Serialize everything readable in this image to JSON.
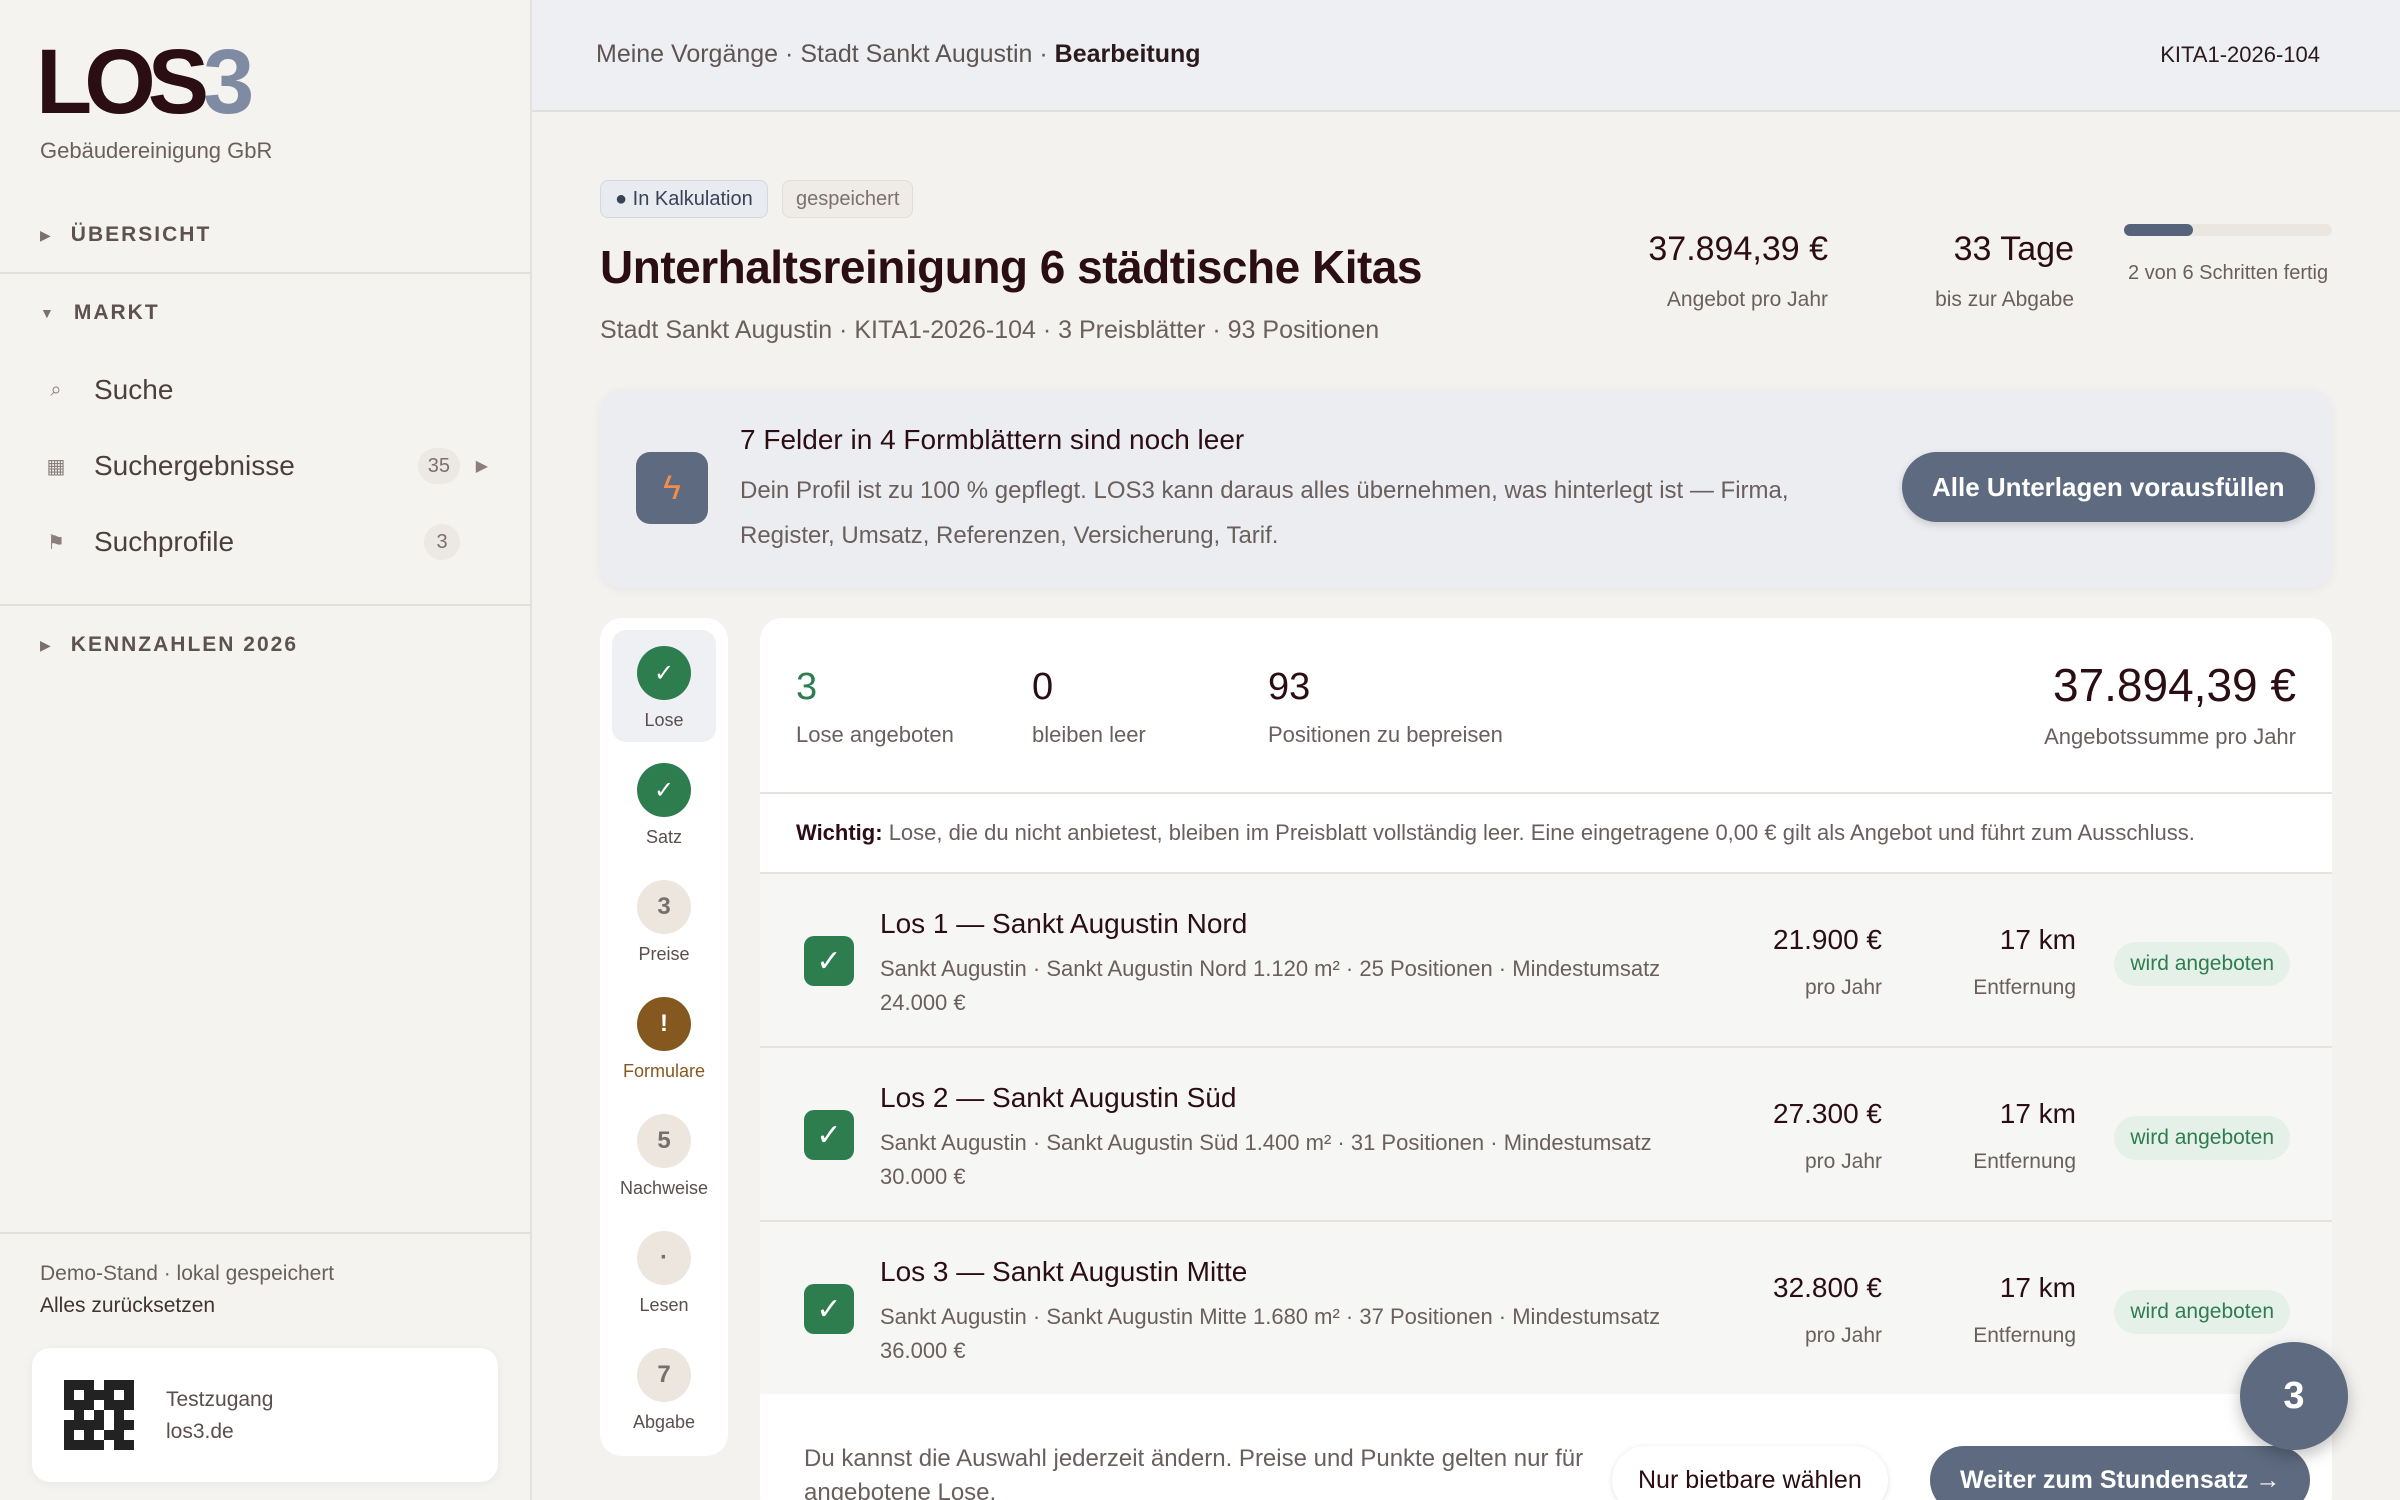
{
  "brand": {
    "logo_main": "LOS",
    "logo_accent": "3",
    "company": "Gebäudereinigung GbR"
  },
  "sidebar": {
    "sections": [
      {
        "label": "ÜBERSICHT",
        "expanded": false
      },
      {
        "label": "MARKT",
        "expanded": true
      },
      {
        "label": "KENNZAHLEN 2026",
        "expanded": false
      }
    ],
    "items": [
      {
        "label": "Suche",
        "icon": "search-icon"
      },
      {
        "label": "Suchergebnisse",
        "icon": "grid-icon",
        "count": "35"
      },
      {
        "label": "Suchprofile",
        "icon": "flag-icon",
        "count": "3"
      }
    ],
    "footer": {
      "status": "Demo-Stand · lokal gespeichert",
      "reset": "Alles zurücksetzen",
      "qr_line1": "Testzugang",
      "qr_line2": "los3.de"
    }
  },
  "topbar": {
    "crumb_1": "Meine Vorgänge",
    "crumb_2": "Stadt Sankt Augustin",
    "crumb_current": "Bearbeitung",
    "case_id": "KITA1-2026-104"
  },
  "header": {
    "status_badge": "In Kalkulation",
    "saved_badge": "gespeichert",
    "title": "Unterhaltsreinigung 6 städtische Kitas",
    "subtitle": "Stadt Sankt Augustin · KITA1-2026-104 · 3 Preisblätter · 93 Positionen",
    "kpi_offer_value": "37.894,39 €",
    "kpi_offer_label": "Angebot pro Jahr",
    "kpi_days_value": "33 Tage",
    "kpi_days_label": "bis zur Abgabe",
    "progress_fraction": 0.33,
    "progress_label": "2 von 6 Schritten fertig"
  },
  "alert": {
    "title": "7 Felder in 4 Formblättern sind noch leer",
    "text": "Dein Profil ist zu 100 % gepflegt. LOS3 kann daraus alles übernehmen, was hinterlegt ist — Firma, Register, Umsatz, Referenzen, Versicherung, Tarif.",
    "button": "Alle Unterlagen vorausfüllen"
  },
  "steps": [
    {
      "mark": "✓",
      "label": "Lose",
      "state": "done"
    },
    {
      "mark": "✓",
      "label": "Satz",
      "state": "done"
    },
    {
      "mark": "3",
      "label": "Preise",
      "state": "todo"
    },
    {
      "mark": "!",
      "label": "Formulare",
      "state": "warn"
    },
    {
      "mark": "5",
      "label": "Nachweise",
      "state": "todo"
    },
    {
      "mark": "·",
      "label": "Lesen",
      "state": "todo"
    },
    {
      "mark": "7",
      "label": "Abgabe",
      "state": "todo"
    }
  ],
  "summary": {
    "offered_value": "3",
    "offered_label": "Lose angeboten",
    "empty_value": "0",
    "empty_label": "bleiben leer",
    "positions_value": "93",
    "positions_label": "Positionen zu bepreisen",
    "total_value": "37.894,39 €",
    "total_label": "Angebotssumme pro Jahr",
    "note_bold": "Wichtig:",
    "note_text": "Lose, die du nicht anbietest, bleiben im Preisblatt vollständig leer. Eine eingetragene 0,00 € gilt als Angebot und führt zum Ausschluss."
  },
  "lose": [
    {
      "title": "Los 1 — Sankt Augustin Nord",
      "desc": "Sankt Augustin · Sankt Augustin Nord 1.120 m² · 25 Positionen · Mindestumsatz 24.000 €",
      "price": "21.900 €",
      "price_label": "pro Jahr",
      "distance": "17 km",
      "distance_label": "Entfernung",
      "tag": "wird angeboten"
    },
    {
      "title": "Los 2 — Sankt Augustin Süd",
      "desc": "Sankt Augustin · Sankt Augustin Süd 1.400 m² · 31 Positionen · Mindestumsatz 30.000 €",
      "price": "27.300 €",
      "price_label": "pro Jahr",
      "distance": "17 km",
      "distance_label": "Entfernung",
      "tag": "wird angeboten"
    },
    {
      "title": "Los 3 — Sankt Augustin Mitte",
      "desc": "Sankt Augustin · Sankt Augustin Mitte 1.680 m² · 37 Positionen · Mindestumsatz 36.000 €",
      "price": "32.800 €",
      "price_label": "pro Jahr",
      "distance": "17 km",
      "distance_label": "Entfernung",
      "tag": "wird angeboten"
    }
  ],
  "footer": {
    "text": "Du kannst die Auswahl jederzeit ändern. Preise und Punkte gelten nur für angebotene Lose.",
    "button_secondary": "Nur bietbare wählen",
    "button_primary": "Weiter zum Stundensatz →"
  },
  "fab": {
    "label": "3"
  },
  "colors": {
    "brand_dark": "#2b0d14",
    "accent": "#5d6a80",
    "success": "#2e7d4f",
    "warning": "#85581f"
  }
}
